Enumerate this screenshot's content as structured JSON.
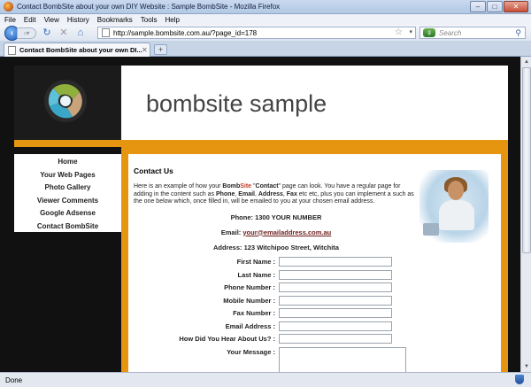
{
  "window": {
    "title": "Contact BombSite about your own DIY Website : Sample BombSite - Mozilla Firefox"
  },
  "menu": [
    "File",
    "Edit",
    "View",
    "History",
    "Bookmarks",
    "Tools",
    "Help"
  ],
  "toolbar": {
    "url": "http://sample.bombsite.com.au/?page_id=178",
    "search_placeholder": "Search"
  },
  "tab": {
    "label": "Contact BombSite about your own DI...",
    "new_tab": "+"
  },
  "site": {
    "title": "bombsite sample",
    "nav": [
      "Home",
      "Your Web Pages",
      "Photo Gallery",
      "Viewer Comments",
      "Google Adsense",
      "Contact BombSite"
    ],
    "page_heading": "Contact Us",
    "intro_parts": {
      "a": "Here is an example of how your ",
      "brand1": "Bomb",
      "brand2": "Site",
      "b": " \"",
      "contact": "Contact",
      "c": "\" page can look. You have a regular page for adding in the content such as ",
      "phone": "Phone",
      "d": ", ",
      "email": "Email",
      "e": ", ",
      "address": "Address",
      "f": ", ",
      "fax": "Fax",
      "g": " etc etc, plus you can implement a such as the one below which, once filled in, will be emailed to you at your chosen email address."
    },
    "phone_line": "Phone: 1300 YOUR NUMBER",
    "email_label": "Email: ",
    "email_value": "your@emailaddress.com.au",
    "address_line": "Address: 123 Witchipoo Street, Witchita"
  },
  "form": {
    "fields": [
      "First Name :",
      "Last Name :",
      "Phone Number :",
      "Mobile Number :",
      "Fax Number :",
      "Email Address :",
      "How Did You Hear About Us? :"
    ],
    "message_label": "Your Message :"
  },
  "status": "Done"
}
